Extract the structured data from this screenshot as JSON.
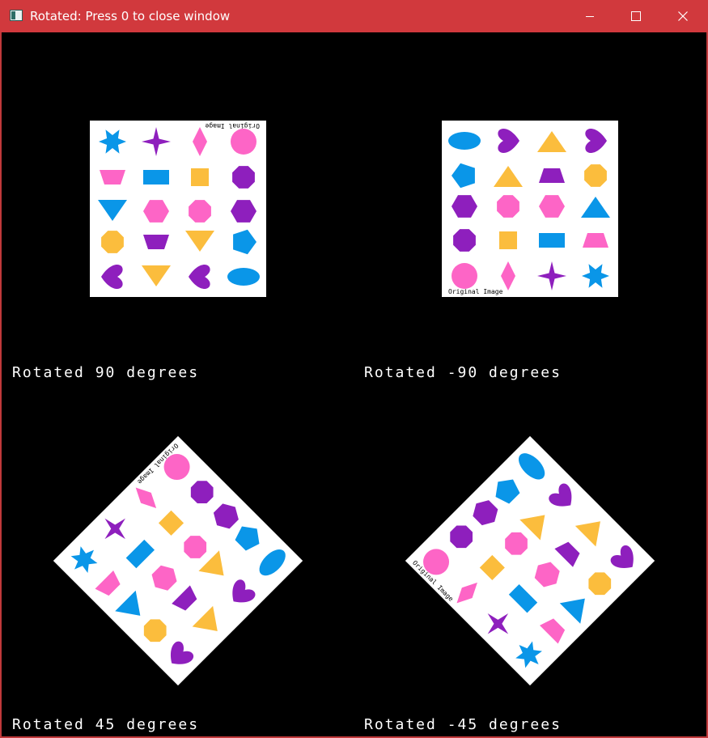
{
  "window": {
    "title": "Rotated: Press 0 to close window",
    "controls": [
      "minimize",
      "maximize",
      "close"
    ]
  },
  "panels": [
    {
      "label": "Rotated 90 degrees",
      "rotation": 90
    },
    {
      "label": "Rotated -90 degrees",
      "rotation": -90
    },
    {
      "label": "Rotated 45 degrees",
      "rotation": 45
    },
    {
      "label": "Rotated -45 degrees",
      "rotation": -45
    }
  ],
  "image_caption": "Original Image",
  "colors": {
    "purple": "#8e1fbd",
    "yellow": "#fbbd3d",
    "blue": "#0a96e8",
    "pink": "#fd65c6",
    "background": "#000000",
    "titlebar": "#d1393d"
  }
}
